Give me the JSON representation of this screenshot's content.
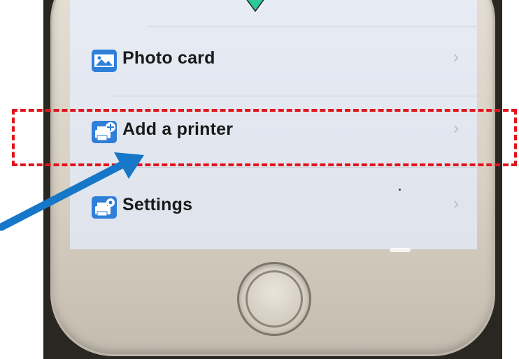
{
  "menu": {
    "items": [
      {
        "label": "Photo card",
        "icon": "photo-card-icon"
      },
      {
        "label": "Add a printer",
        "icon": "add-printer-icon"
      },
      {
        "label": "Settings",
        "icon": "printer-settings-icon"
      }
    ],
    "chevron": "›"
  },
  "annotations": {
    "highlight_color": "#e0141b",
    "arrow_color": "#1677c8",
    "marker_color": "#2ec79a"
  }
}
